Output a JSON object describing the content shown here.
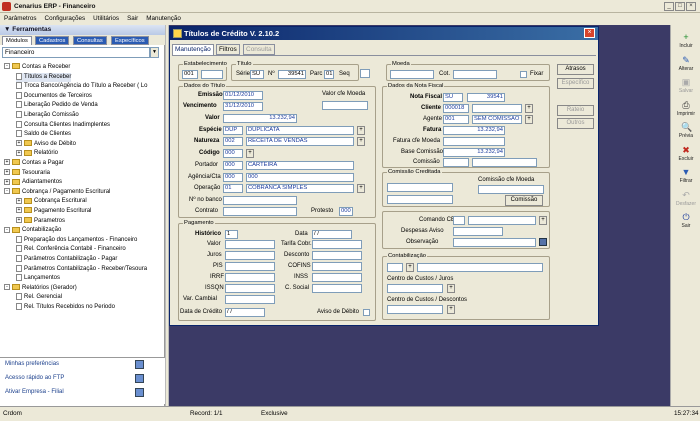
{
  "app": {
    "title": "Cenarius ERP - Financeiro"
  },
  "menu": [
    "Parâmetros",
    "Configurações",
    "Utilitários",
    "Sair",
    "Manutenção"
  ],
  "left": {
    "header": "Ferramentas",
    "tabs": [
      "Módulos",
      "Cadastros",
      "Consultas",
      "Específicos"
    ],
    "module_select": "Financeiro",
    "tree": [
      {
        "label": "Contas a Receber",
        "level": 0,
        "kind": "folder",
        "exp": "-"
      },
      {
        "label": "Títulos a Receber",
        "level": 1,
        "kind": "doc",
        "selected": true
      },
      {
        "label": "Troca Banco/Agência do Título a Receber ( Lo",
        "level": 1,
        "kind": "doc"
      },
      {
        "label": "Documentos de Terceiros",
        "level": 1,
        "kind": "doc"
      },
      {
        "label": "Liberação Pedido de Venda",
        "level": 1,
        "kind": "doc"
      },
      {
        "label": "Liberação Comissão",
        "level": 1,
        "kind": "doc"
      },
      {
        "label": "Consulta Clientes Inadimplentes",
        "level": 1,
        "kind": "doc"
      },
      {
        "label": "Saldo de Clientes",
        "level": 1,
        "kind": "doc"
      },
      {
        "label": "Aviso de Débito",
        "level": 1,
        "kind": "folder",
        "exp": "+"
      },
      {
        "label": "Relatório",
        "level": 1,
        "kind": "folder",
        "exp": "+"
      },
      {
        "label": "Contas a Pagar",
        "level": 0,
        "kind": "folder",
        "exp": "+"
      },
      {
        "label": "Tesouraria",
        "level": 0,
        "kind": "folder",
        "exp": "+"
      },
      {
        "label": "Adiantamentos",
        "level": 0,
        "kind": "folder",
        "exp": "+"
      },
      {
        "label": "Cobrança / Pagamento Escritural",
        "level": 0,
        "kind": "folder",
        "exp": "-"
      },
      {
        "label": "Cobrança Escritural",
        "level": 1,
        "kind": "folder",
        "exp": "+"
      },
      {
        "label": "Pagamento Escritural",
        "level": 1,
        "kind": "folder",
        "exp": "+"
      },
      {
        "label": "Parametros",
        "level": 1,
        "kind": "folder",
        "exp": "+"
      },
      {
        "label": "Contabilização",
        "level": 0,
        "kind": "folder",
        "exp": "-"
      },
      {
        "label": "Preparação dos Lançamentos - Financeiro",
        "level": 1,
        "kind": "doc"
      },
      {
        "label": "Rel. Conferência Contabil - Financeiro",
        "level": 1,
        "kind": "doc"
      },
      {
        "label": "Parâmetros Contabilização - Pagar",
        "level": 1,
        "kind": "doc"
      },
      {
        "label": "Parâmetros Contabilização - Receber/Tesoura",
        "level": 1,
        "kind": "doc"
      },
      {
        "label": "Lançamentos",
        "level": 1,
        "kind": "doc"
      },
      {
        "label": "Relatórios (Gerador)",
        "level": 0,
        "kind": "folder",
        "exp": "-"
      },
      {
        "label": "Rel. Gerencial",
        "level": 1,
        "kind": "doc"
      },
      {
        "label": "Rel. Títulos Recebidos no Periodo",
        "level": 1,
        "kind": "doc"
      }
    ],
    "quick": [
      "Minhas preferências",
      "Acesso rápido ao FTP",
      "Ativar Empresa - Filial"
    ]
  },
  "right_toolbar": [
    {
      "label": "Incluir",
      "icon": "+",
      "enabled": true
    },
    {
      "label": "Alterar",
      "icon": "✎",
      "enabled": true
    },
    {
      "label": "Salvar",
      "icon": "▣",
      "enabled": false
    },
    {
      "label": "Imprimir",
      "icon": "⎙",
      "enabled": true
    },
    {
      "label": "Prévia",
      "icon": "🔍",
      "enabled": true
    },
    {
      "label": "Excluir",
      "icon": "✖",
      "enabled": true
    },
    {
      "label": "Filtrar",
      "icon": "▼",
      "enabled": true
    },
    {
      "label": "Desfazer",
      "icon": "↶",
      "enabled": false
    },
    {
      "label": "Sair",
      "icon": "⏻",
      "enabled": true
    }
  ],
  "status": {
    "user": "Crdom",
    "record": "Record: 1/1",
    "mode": "Exclusive",
    "time": "15:27:34"
  },
  "win": {
    "title": "Títulos de Crédito  V. 2.10.2",
    "tabs": [
      "Manutenção",
      "Filtros",
      "Consulta"
    ],
    "estabelecimento": {
      "label": "Estabelecimento",
      "v1": "001",
      "v2": ""
    },
    "titulo": {
      "label": "Título",
      "serie_l": "Série",
      "serie": "SU",
      "n_l": "Nº",
      "numero": "39541",
      "parc_l": "Parc",
      "parc": "01",
      "seq_l": "Seq",
      "seq": ""
    },
    "moeda": {
      "label": "Moeda",
      "cot_l": "Cot.",
      "fixar_l": "Fixar"
    },
    "dados_titulo": {
      "label": "Dados do Título",
      "emissao_l": "Emissão",
      "emissao": "01/12/2010",
      "venc_l": "Vencimento",
      "venc": "31/12/2010",
      "valor_cfe_l": "Valor cfe Moeda",
      "valor_l": "Valor",
      "valor": "13.232,94",
      "especie_l": "Espécie",
      "especie_cod": "DUP",
      "especie_desc": "DUPLICATA",
      "natureza_l": "Natureza",
      "natureza_cod": "002",
      "natureza_desc": "RECEITA DE VENDAS",
      "codigo_l": "Código",
      "codigo": "000",
      "portador_l": "Portador",
      "portador_cod": "000",
      "portador_desc": "CARTEIRA",
      "agencia_l": "Agência/Cta",
      "agencia": "000",
      "conta": "000",
      "operacao_l": "Operação",
      "operacao_cod": "01",
      "operacao_desc": "COBRANCA SIMPLES",
      "nbanco_l": "Nº no banco",
      "contrato_l": "Contrato",
      "protesto_l": "Protesto",
      "protesto": "000"
    },
    "pagamento": {
      "label": "Pagamento",
      "historico_l": "Histórico",
      "historico": "1",
      "data_l": "Data",
      "data": "  /  /",
      "valor_l": "Valor",
      "tarifa_l": "Tarifa Cobr.",
      "juros_l": "Juros",
      "desconto_l": "Desconto",
      "pis_l": "PIS",
      "cofins_l": "COFINS",
      "irrf_l": "IRRF",
      "inss_l": "INSS",
      "issqn_l": "ISSQN",
      "csocial_l": "C. Social",
      "varcambial_l": "Var. Cambial",
      "datacredito_l": "Data de Crédito",
      "datacredito": "  /  /",
      "avisodebito_l": "Aviso de Débito"
    },
    "nota": {
      "label": "Dados da Nota Fiscal",
      "nf_l": "Nota Fiscal",
      "nf_serie": "SU",
      "nf_num": "39541",
      "cliente_l": "Cliente",
      "cliente": "000018",
      "agente_l": "Agente",
      "agente": "001",
      "agente_desc": "SEM COMISSÃO",
      "fatura_l": "Fatura",
      "fatura": "13.232,94",
      "faturamoeda_l": "Fatura cfe Moeda",
      "basecom_l": "Base Comissão",
      "basecom": "13.232,94",
      "comissao_l": "Comissão"
    },
    "comcred": {
      "label": "Comissão Creditada",
      "moeda_l": "Comissão cfe Moeda",
      "btn": "Comissão"
    },
    "comando": {
      "ce_l": "Comando CE",
      "desp_l": "Despesas Aviso",
      "obs_l": "Observação"
    },
    "contab": {
      "label": "Contabilização",
      "cc_juros_l": "Centro de Custos / Juros",
      "cc_desc_l": "Centro de Custos / Descontos"
    },
    "side_buttons": [
      {
        "label": "Atrasos",
        "enabled": true
      },
      {
        "label": "Específico",
        "enabled": false
      },
      {
        "label": "Rateio",
        "enabled": false
      },
      {
        "label": "Outros",
        "enabled": false
      }
    ]
  }
}
